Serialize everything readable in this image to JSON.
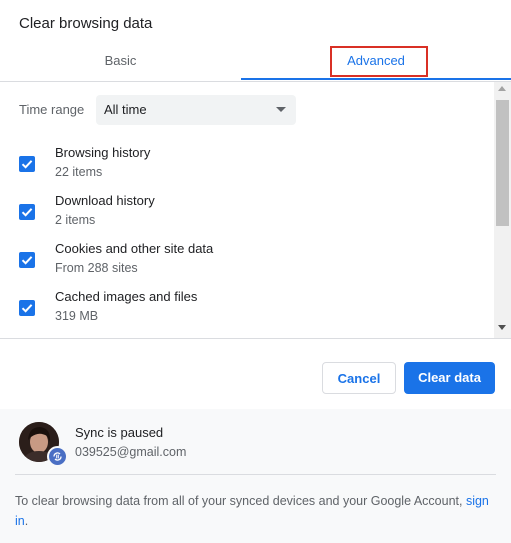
{
  "dialog": {
    "title": "Clear browsing data"
  },
  "tabs": [
    {
      "label": "Basic",
      "selected": false
    },
    {
      "label": "Advanced",
      "selected": true
    }
  ],
  "time_range": {
    "label": "Time range",
    "value": "All time"
  },
  "options": [
    {
      "title": "Browsing history",
      "subtitle": "22 items",
      "checked": true
    },
    {
      "title": "Download history",
      "subtitle": "2 items",
      "checked": true
    },
    {
      "title": "Cookies and other site data",
      "subtitle": "From 288 sites",
      "checked": true
    },
    {
      "title": "Cached images and files",
      "subtitle": "319 MB",
      "checked": true
    }
  ],
  "buttons": {
    "cancel": "Cancel",
    "clear": "Clear data"
  },
  "sync": {
    "status": "Sync is paused",
    "email": "039525@gmail.com",
    "note": "To clear browsing data from all of your synced devices and your Google Account,",
    "sign_in": "sign in",
    "period": "."
  },
  "colors": {
    "accent": "#1a73e8",
    "highlight": "#d93025"
  },
  "icons": [
    "checkbox-checked-icon",
    "dropdown-arrow-icon",
    "sync-paused-icon"
  ]
}
